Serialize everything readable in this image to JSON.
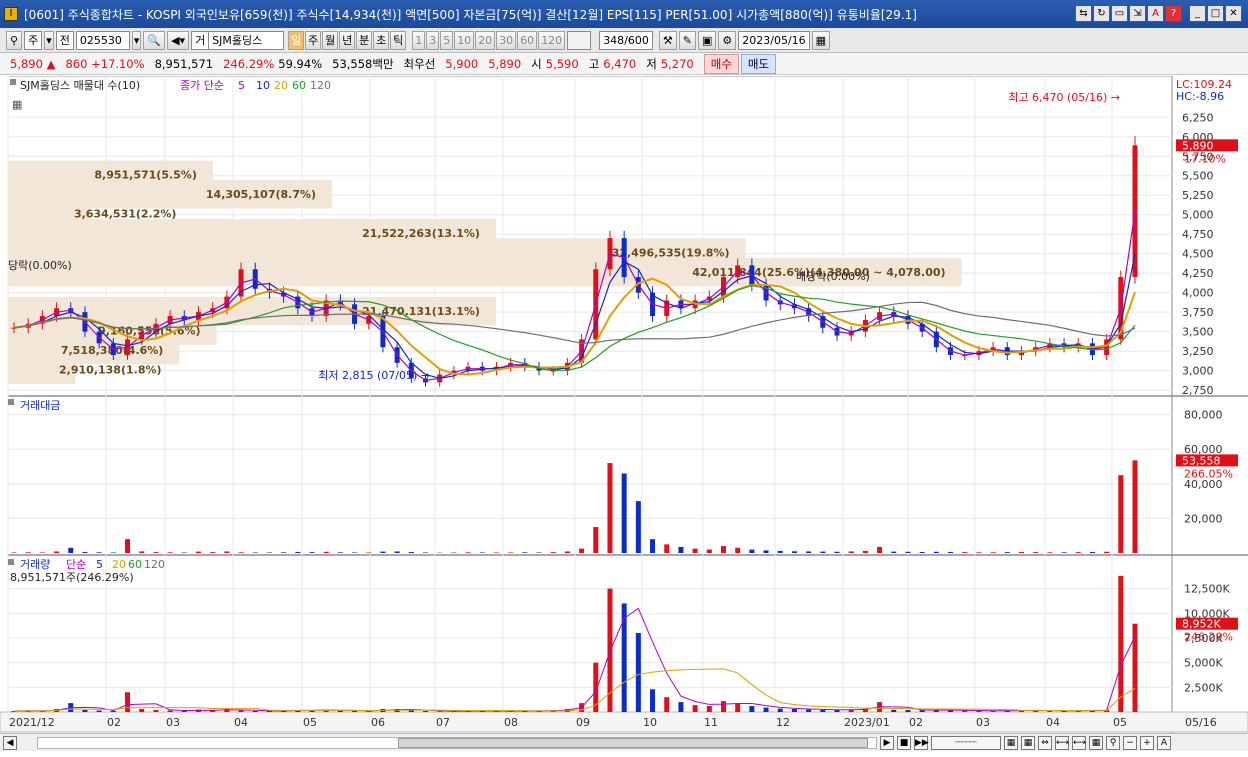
{
  "window": {
    "title": "[0601] 주식종합차트 - KOSPI 외국인보유[659(천)] 주식수[14,934(천)] 액면[500] 자본금[75(억)] 결산[12월] EPS[115] PER[51.00] 시가총액[880(억)] 유통비율[29.1]",
    "app_icon": "I"
  },
  "toolbar": {
    "market": "주",
    "prefix": "전",
    "code": "025530",
    "type_prefix": "거",
    "name": "SJM홀딩스",
    "periods": [
      "일",
      "주",
      "월",
      "년",
      "분",
      "초",
      "틱"
    ],
    "active_period": "일",
    "intervals": [
      "1",
      "3",
      "5",
      "10",
      "20",
      "30",
      "60",
      "120"
    ],
    "count": "348",
    "count_max": "/600",
    "date": "2023/05/16"
  },
  "info": {
    "price": "5,890",
    "arrow": "▲",
    "change": "860",
    "change_rate": "+17.10%",
    "volume": "8,951,571",
    "volume_rate": "246.29%",
    "volume_rate2": "59.94%",
    "amount": "53,558백만",
    "ask_label": "최우선",
    "ask": "5,900",
    "bid": "5,890",
    "open_label": "시",
    "open": "5,590",
    "high_label": "고",
    "high": "6,470",
    "low_label": "저",
    "low": "5,270",
    "buy": "매수",
    "sell": "매도"
  },
  "colors": {
    "up": "#e0101a",
    "down": "#0c2cc6",
    "ma5": "#b000d0",
    "ma10": "#0c2cc6",
    "ma20": "#e0a000",
    "ma60": "#20a020",
    "ma120": "#707070",
    "band": "#f2e6d8",
    "grid": "#e8e8e8"
  },
  "chart_data": [
    {
      "type": "line",
      "title": "SJM홀딩스 매물대 수(10)",
      "legend_label": "종가 단순",
      "ma_periods": [
        "5",
        "10",
        "20",
        "60",
        "120"
      ],
      "x_axis_labels": [
        "2021/12",
        "02",
        "03",
        "04",
        "05",
        "06",
        "07",
        "08",
        "09",
        "10",
        "11",
        "12",
        "2023/01",
        "02",
        "03",
        "04",
        "05"
      ],
      "end_date": "05/16",
      "ylim": [
        2700,
        6600
      ],
      "yticks": [
        "6,250",
        "6,000",
        "5,750",
        "5,500",
        "5,250",
        "5,000",
        "4,750",
        "4,500",
        "4,250",
        "4,000",
        "3,750",
        "3,500",
        "3,250",
        "3,000",
        "2,750"
      ],
      "top_labels": [
        "LC:109.24",
        "HC:-8.96"
      ],
      "price_tag": "5,890",
      "change_tag": "17.10%",
      "annotations": {
        "high": "최고 6,470 (05/16)",
        "low": "최저 2,815 (07/05)",
        "event1": "당락(0.00%)",
        "event2": "배당락(0.00%)"
      },
      "volume_profile": [
        {
          "label": "2,910,138(1.8%)",
          "price": 3000,
          "size": 0.018
        },
        {
          "label": "7,518,380(4.6%)",
          "price": 3250,
          "size": 0.046
        },
        {
          "label": "9,160,558(5.6%)",
          "price": 3500,
          "size": 0.056
        },
        {
          "label": "21,470,131(13.1%)",
          "price": 3750,
          "size": 0.131
        },
        {
          "label": "42,011,844(25.6%)(4,380.00 ~ 4,078.00)",
          "price": 4250,
          "size": 0.256
        },
        {
          "label": "32,496,535(19.8%)",
          "price": 4500,
          "size": 0.198
        },
        {
          "label": "21,522,263(13.1%)",
          "price": 4750,
          "size": 0.131
        },
        {
          "label": "3,634,531(2.2%)",
          "price": 5000,
          "size": 0.022
        },
        {
          "label": "14,305,107(8.7%)",
          "price": 5250,
          "size": 0.087
        },
        {
          "label": "8,951,571(5.5%)",
          "price": 5500,
          "size": 0.055
        }
      ],
      "close": [
        3550,
        3600,
        3700,
        3800,
        3750,
        3500,
        3350,
        3200,
        3400,
        3500,
        3600,
        3700,
        3650,
        3750,
        3800,
        3950,
        4300,
        4050,
        4000,
        3950,
        3800,
        3700,
        3900,
        3850,
        3600,
        3700,
        3300,
        3100,
        2900,
        2850,
        2950,
        3000,
        3050,
        3000,
        3050,
        3100,
        3050,
        3000,
        3000,
        3100,
        3400,
        4300,
        4700,
        4200,
        4000,
        3700,
        3900,
        3800,
        3900,
        3950,
        4200,
        4350,
        4100,
        3900,
        3850,
        3800,
        3700,
        3550,
        3450,
        3500,
        3650,
        3750,
        3700,
        3600,
        3500,
        3300,
        3200,
        3200,
        3250,
        3300,
        3200,
        3250,
        3300,
        3350,
        3300,
        3350,
        3200,
        3400,
        4200,
        5890
      ]
    },
    {
      "type": "bar",
      "title": "거래대금",
      "ylim": [
        0,
        85000
      ],
      "yticks": [
        "80,000",
        "60,000",
        "40,000",
        "20,000"
      ],
      "tag_value": "53,558",
      "tag_rate": "266.05%",
      "values": [
        300,
        400,
        300,
        900,
        3000,
        600,
        400,
        300,
        8000,
        900,
        500,
        400,
        300,
        800,
        500,
        900,
        400,
        300,
        300,
        400,
        600,
        500,
        700,
        400,
        300,
        300,
        800,
        900,
        600,
        300,
        200,
        300,
        400,
        300,
        300,
        300,
        400,
        300,
        500,
        900,
        2500,
        15000,
        52000,
        46000,
        30000,
        8000,
        5000,
        3500,
        2500,
        2000,
        4000,
        3000,
        2000,
        1500,
        1200,
        1000,
        900,
        800,
        700,
        900,
        1200,
        3500,
        800,
        700,
        600,
        700,
        600,
        500,
        400,
        400,
        500,
        600,
        500,
        400,
        400,
        500,
        600,
        700,
        45000,
        53558
      ]
    },
    {
      "type": "bar",
      "title": "거래량",
      "legend_label": "단순",
      "ma_periods": [
        "5",
        "20",
        "60",
        "120"
      ],
      "summary": "8,951,571주(246.29%)",
      "ylim": [
        0,
        15000
      ],
      "yticks": [
        "12,500K",
        "10,000K",
        "7,500K",
        "5,000K",
        "2,500K"
      ],
      "tag_value": "8,952K",
      "tag_rate": "246.29%",
      "values": [
        100,
        150,
        100,
        300,
        900,
        200,
        150,
        100,
        2000,
        300,
        200,
        150,
        100,
        250,
        150,
        300,
        150,
        100,
        100,
        150,
        200,
        150,
        250,
        150,
        100,
        100,
        300,
        300,
        200,
        100,
        80,
        100,
        130,
        100,
        100,
        100,
        130,
        100,
        170,
        300,
        900,
        5000,
        12500,
        11000,
        8000,
        2300,
        1500,
        1000,
        700,
        600,
        1100,
        900,
        600,
        450,
        350,
        300,
        250,
        230,
        200,
        250,
        330,
        1000,
        230,
        200,
        180,
        200,
        180,
        150,
        120,
        120,
        150,
        180,
        150,
        120,
        120,
        150,
        180,
        200,
        13800,
        8952
      ]
    }
  ],
  "scrollbar": {
    "zoom_in": "+",
    "zoom_out": "−",
    "play_label": "▶"
  }
}
